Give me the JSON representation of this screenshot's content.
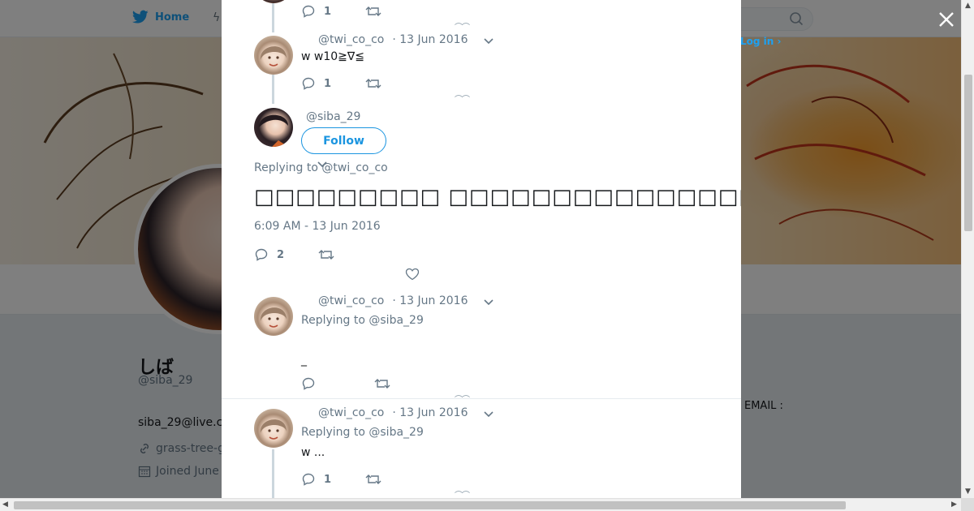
{
  "topbar": {
    "home_label": "Home",
    "login_label": "Log in",
    "login_suffix": " ›"
  },
  "profile": {
    "name": "しば",
    "handle": "@siba_29",
    "bio": "siba_29@live.c",
    "link": "grass-tree-g",
    "joined": "Joined June",
    "email_label": "EMAIL :"
  },
  "colors": {
    "accent": "#1da1f2",
    "secondary_text": "#657786",
    "thread_line": "#ccd6dd"
  },
  "tweets": [
    {
      "handle": "@twi_co_co",
      "date": "· 13 Jun 2016",
      "text": "w w10≧∇≦",
      "reply_count": "1"
    },
    {
      "handle": "@siba_29",
      "follow_label": "Follow",
      "replying_prefix": "Replying to ",
      "replying_to": "@twi_co_co",
      "text": "□□□□□□□□□ □□□□□□□□□□□□□□□□□□□□□□□□□□□□□□□□□□□□□□□□□□□□□□□□□□□□□□□□□□",
      "timestamp": "6:09 AM - 13 Jun 2016",
      "reply_count": "2"
    },
    {
      "handle": "@twi_co_co",
      "date": "· 13 Jun 2016",
      "replying_prefix": "Replying to ",
      "replying_to": "@siba_29",
      "text": "_",
      "reply_count": ""
    },
    {
      "handle": "@twi_co_co",
      "date": "· 13 Jun 2016",
      "replying_prefix": "Replying to ",
      "replying_to": "@siba_29",
      "text": "w  ...",
      "reply_count": "1"
    }
  ],
  "top_partial": {
    "reply_count": "1"
  }
}
